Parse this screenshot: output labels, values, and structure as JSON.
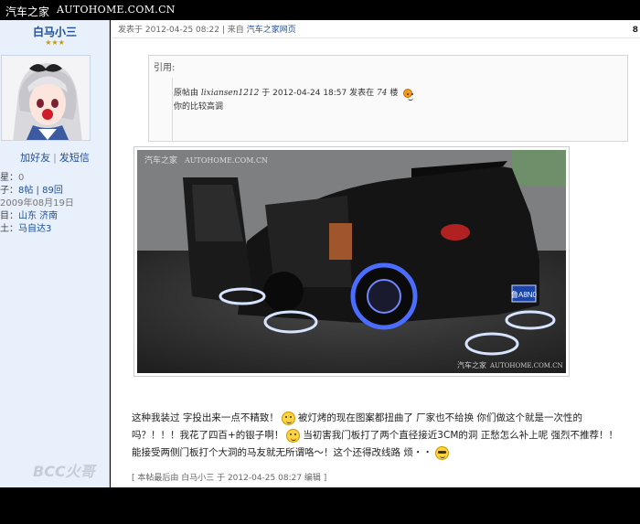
{
  "topbar": {
    "logo": "汽车之家",
    "site": "AUTOHOME.COM.CN"
  },
  "sidebar": {
    "username": "白马小三",
    "stars": "★★★",
    "actions": {
      "add_friend": "加好友",
      "send_msg": "发短信",
      "separator": "|"
    },
    "stats": [
      {
        "k": "星：",
        "v": "0"
      },
      {
        "k": "子：",
        "v": "8帖 | 89回"
      },
      {
        "k": "",
        "v": "2009年08月19日"
      },
      {
        "k": "目：",
        "v": "山东 济南"
      },
      {
        "k": "土：",
        "v": "马自达3"
      }
    ],
    "watermark": "BCC火哥"
  },
  "post": {
    "posted_label": "发表于",
    "posted_time": "2012-04-25 08:22",
    "separator": "|",
    "from_label": "来自",
    "from_source": "汽车之家网页",
    "floor": "8"
  },
  "quote": {
    "label": "引用:",
    "meta_prefix": "原帖由",
    "author": "lixiansen1212",
    "meta_mid": "于 2012-04-24 18:57 发表在",
    "floor_ref": "74",
    "floor_suffix": "楼",
    "text": "你的比较高调"
  },
  "photo": {
    "watermark_top": "汽车之家",
    "watermark_top_site": "AUTOHOME.COM.CN",
    "watermark_bottom": "汽车之家",
    "watermark_bottom_site": "AUTOHOME.COM.CN",
    "plate": "鲁A8N0"
  },
  "body": {
    "l1a": "这种我装过 字投出来一点不精致！",
    "l1b": "被灯烤的现在图案都扭曲了 厂家也不给换 你们做这个就是一次性的",
    "l2a": "吗？！！！我花了四百+的银子啊！",
    "l2b": "当初害我门板打了两个直径接近3CM的洞 正愁怎么补上呢 强烈不推荐！！",
    "l3a": "能接受两侧门板打个大洞的马友就无所谓咯～！这个还得改线路 烦・・"
  },
  "edited": "[ 本帖最后由 白马小三 于 2012-04-25 08:27 编辑 ]"
}
